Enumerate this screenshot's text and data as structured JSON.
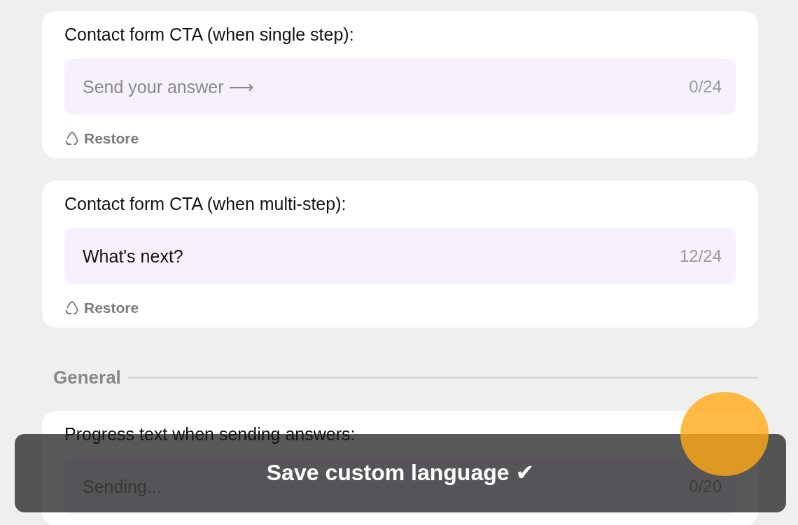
{
  "fields": [
    {
      "label": "Contact form CTA (when single step):",
      "placeholder": "Send your answer ⟶",
      "counter": "0/24",
      "restore": "Restore"
    },
    {
      "label": "Contact form CTA (when multi-step):",
      "value": "What's next?",
      "counter": "12/24",
      "restore": "Restore"
    }
  ],
  "section": {
    "title": "General"
  },
  "partial_field": {
    "label": "Progress text when sending answers:",
    "placeholder": "Sending...",
    "counter": "0/20"
  },
  "save_button": {
    "label": "Save custom language ✔"
  }
}
